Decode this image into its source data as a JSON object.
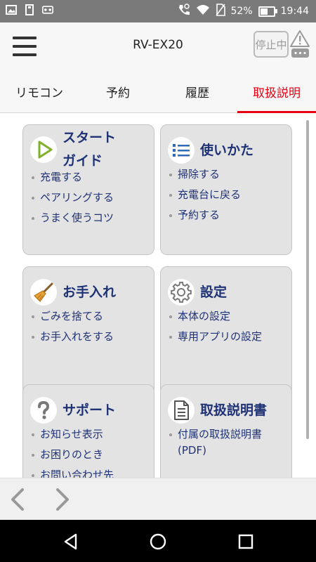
{
  "status_bar": {
    "battery_percent": "52%",
    "battery_level": 0.52,
    "time": "19:44",
    "icons": [
      "image-icon",
      "sd-card-icon",
      "voicemail-icon",
      "call-settings-icon",
      "wifi-icon",
      "no-sim-icon",
      "battery-icon"
    ]
  },
  "app_bar": {
    "title": "RV-EX20",
    "stop_label": "停止中",
    "icons": [
      "menu-icon",
      "warning-icon"
    ]
  },
  "tabs": [
    {
      "label": "リモコン",
      "active": false
    },
    {
      "label": "予約",
      "active": false
    },
    {
      "label": "履歴",
      "active": false
    },
    {
      "label": "取扱説明",
      "active": true
    }
  ],
  "colors": {
    "accent": "#e60012",
    "card_title": "#1f3276",
    "card_bg": "#e3e3e3",
    "icon_green": "#7fb02a",
    "icon_blue": "#2f6bb6"
  },
  "cards": [
    {
      "title_lines": [
        "スタート",
        "ガイド"
      ],
      "icon": "play-icon",
      "links": [
        "充電する",
        "ペアリングする",
        "うまく使うコツ"
      ]
    },
    {
      "title_lines": [
        "使いかた"
      ],
      "icon": "list-icon",
      "links": [
        "掃除する",
        "充電台に戻る",
        "予約する"
      ]
    },
    {
      "title_lines": [
        "お手入れ"
      ],
      "icon": "broom-icon",
      "links": [
        "ごみを捨てる",
        "お手入れをする"
      ]
    },
    {
      "title_lines": [
        "設定"
      ],
      "icon": "gear-icon",
      "links": [
        "本体の設定",
        "専用アプリの設定"
      ]
    },
    {
      "title_lines": [
        "サポート"
      ],
      "icon": "question-icon",
      "links": [
        "お知らせ表示",
        "お困りのとき",
        "お問い合わせ先"
      ]
    },
    {
      "title_lines": [
        "取扱説明書"
      ],
      "icon": "document-icon",
      "links": [
        "付属の取扱説明書",
        "(PDF)"
      ]
    }
  ],
  "browser_nav": {
    "icons": [
      "back-arrow-icon",
      "forward-arrow-icon"
    ]
  },
  "android_nav": {
    "icons": [
      "back-triangle-icon",
      "home-circle-icon",
      "recents-square-icon"
    ]
  }
}
